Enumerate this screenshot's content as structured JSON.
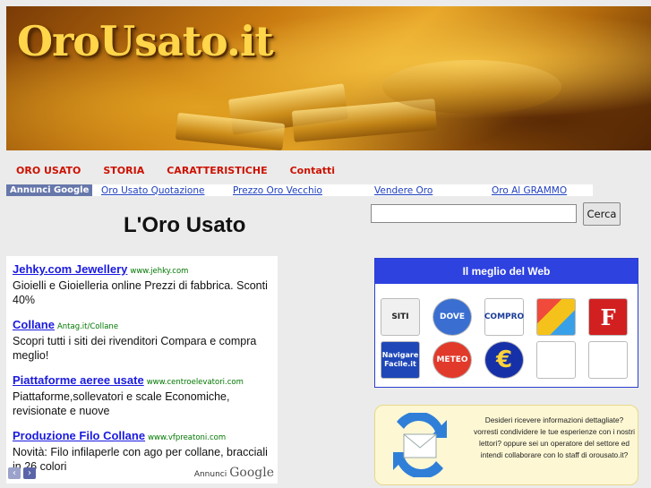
{
  "header": {
    "logo_text": "OroUsato.it"
  },
  "menu": [
    "ORO USATO",
    "STORIA",
    "CARATTERISTICHE",
    "Contatti"
  ],
  "link_row": {
    "tag": "Annunci Google",
    "links": [
      "Oro Usato Quotazione",
      "Prezzo Oro Vecchio",
      "Vendere Oro",
      "Oro Al GRAMMO"
    ]
  },
  "page_title": "L'Oro Usato",
  "search": {
    "value": "",
    "button_label": "Cerca"
  },
  "ads": [
    {
      "title": "Jehky.com Jewellery",
      "url": "www.jehky.com",
      "desc": "Gioielli e Gioielleria online Prezzi di fabbrica. Sconti 40%"
    },
    {
      "title": "Collane",
      "url": "Antag.it/Collane",
      "desc": "Scopri tutti i siti dei rivenditori Compara e compra meglio!"
    },
    {
      "title": "Piattaforme aeree usate",
      "url": "www.centroelevatori.com",
      "desc": "Piattaforme,sollevatori e scale Economiche, revisionate e nuove"
    },
    {
      "title": "Produzione Filo Collane",
      "url": "www.vfpreatoni.com",
      "desc": "Novità: Filo infilaperle con ago per collane, bracciali in 26 colori"
    }
  ],
  "ad_footer": {
    "label": "Annunci",
    "brand": "Google"
  },
  "best_web": {
    "title": "Il meglio del Web",
    "icons": [
      {
        "name": "siti-icon",
        "label": "SITI",
        "bg": "#f0f0f0",
        "color": "#222"
      },
      {
        "name": "dove-icon",
        "label": "DOVE",
        "bg": "#3a6fd1",
        "color": "#ffffff"
      },
      {
        "name": "compro-icon",
        "label": "COMPRO",
        "bg": "#ffffff",
        "color": "#1a3d9a"
      },
      {
        "name": "cube-icon",
        "label": "",
        "bg": "#f4c21a",
        "color": "#222"
      },
      {
        "name": "f-icon",
        "label": "F",
        "bg": "#d22020",
        "color": "#ffffff"
      },
      {
        "name": "navigare-facile-icon",
        "label": "Navigare Facile.it",
        "bg": "#1f47b8",
        "color": "#ffffff"
      },
      {
        "name": "meteo-icon",
        "label": "METEO",
        "bg": "#e23a2a",
        "color": "#ffffff"
      },
      {
        "name": "euro-icon",
        "label": "€",
        "bg": "#1630a8",
        "color": "#ffd23a"
      },
      {
        "name": "chain-icon",
        "label": "",
        "bg": "#ffffff",
        "color": "#1b3c9b"
      },
      {
        "name": "football-icon",
        "label": "",
        "bg": "#ffffff",
        "color": "#111"
      }
    ]
  },
  "info": {
    "text": "Desideri ricevere informazioni dettagliate? vorresti condividere le tue esperienze con i nostri lettori? oppure sei un operatore del settore ed intendi collaborare con lo staff di orousato.it?"
  }
}
